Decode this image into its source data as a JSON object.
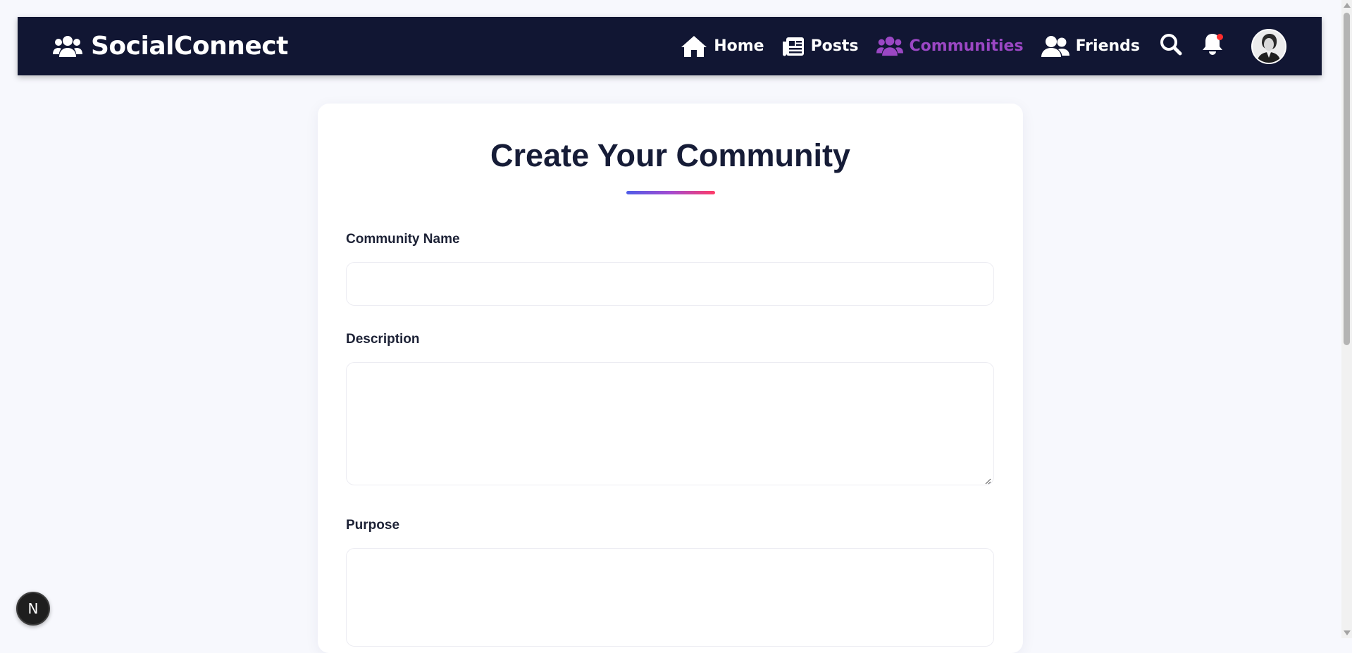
{
  "brand": {
    "title": "SocialConnect",
    "icon": "users-icon"
  },
  "nav": {
    "items": [
      {
        "label": "Home",
        "icon": "home-icon",
        "active": false
      },
      {
        "label": "Posts",
        "icon": "newspaper-icon",
        "active": false
      },
      {
        "label": "Communities",
        "icon": "users-icon",
        "active": true
      },
      {
        "label": "Friends",
        "icon": "user-friends-icon",
        "active": false
      }
    ],
    "search_icon": "search-icon",
    "notification_icon": "bell-icon"
  },
  "form": {
    "title": "Create Your Community",
    "fields": [
      {
        "label": "Community Name",
        "value": "",
        "placeholder": ""
      },
      {
        "label": "Description",
        "value": "",
        "placeholder": ""
      },
      {
        "label": "Purpose",
        "value": "",
        "placeholder": ""
      }
    ]
  },
  "dev_badge": {
    "label": "N"
  },
  "colors": {
    "navbar": "#111633",
    "active": "#9b47c4",
    "page_bg": "#f7f8fd",
    "accent_gradient": [
      "#4f5de8",
      "#a44bd0",
      "#ff3b67"
    ],
    "notification": "#ff2d2d"
  }
}
